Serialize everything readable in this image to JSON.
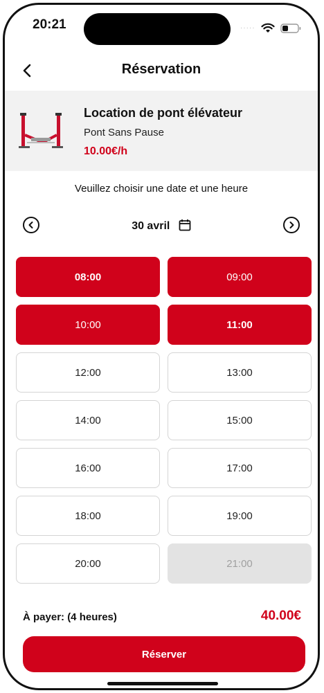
{
  "status_bar": {
    "time": "20:21",
    "signal": "·····"
  },
  "nav": {
    "title": "Réservation"
  },
  "product": {
    "name": "Location de pont élévateur",
    "subtitle": "Pont Sans Pause",
    "price": "10.00€/h"
  },
  "prompt": "Veuillez choisir une date et une heure",
  "date": {
    "label": "30 avril"
  },
  "slots": [
    {
      "time": "08:00",
      "state": "selected",
      "bold": true
    },
    {
      "time": "09:00",
      "state": "selected",
      "bold": false
    },
    {
      "time": "10:00",
      "state": "selected",
      "bold": false
    },
    {
      "time": "11:00",
      "state": "selected",
      "bold": true
    },
    {
      "time": "12:00",
      "state": "available",
      "bold": false
    },
    {
      "time": "13:00",
      "state": "available",
      "bold": false
    },
    {
      "time": "14:00",
      "state": "available",
      "bold": false
    },
    {
      "time": "15:00",
      "state": "available",
      "bold": false
    },
    {
      "time": "16:00",
      "state": "available",
      "bold": false
    },
    {
      "time": "17:00",
      "state": "available",
      "bold": false
    },
    {
      "time": "18:00",
      "state": "available",
      "bold": false
    },
    {
      "time": "19:00",
      "state": "available",
      "bold": false
    },
    {
      "time": "20:00",
      "state": "available",
      "bold": false
    },
    {
      "time": "21:00",
      "state": "disabled",
      "bold": false
    }
  ],
  "total": {
    "label": "À payer:  (4 heures)",
    "amount": "40.00€"
  },
  "reserve_button": {
    "label": "Réserver"
  },
  "colors": {
    "accent": "#d0021b",
    "panel": "#f2f2f2",
    "disabled": "#e3e3e3"
  },
  "icons": [
    "back-arrow-icon",
    "calendar-icon",
    "chevron-left-circle-icon",
    "chevron-right-circle-icon",
    "wifi-icon",
    "battery-icon"
  ]
}
